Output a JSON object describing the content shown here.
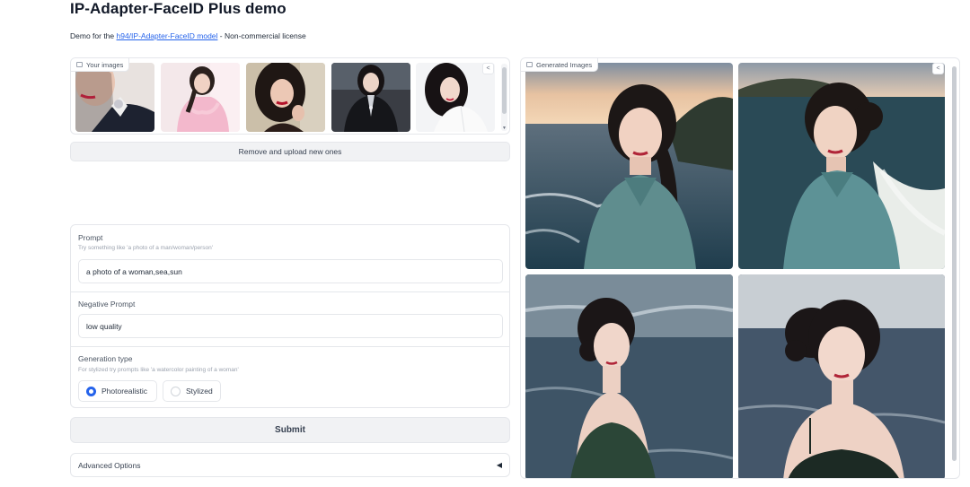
{
  "header": {
    "title": "IP-Adapter-FaceID Plus demo",
    "desc_prefix": "Demo for the ",
    "desc_link": "h94/IP-Adapter-FaceID model",
    "desc_suffix": " - Non-commercial license"
  },
  "input_gallery": {
    "label": "Your images",
    "thumbnail_count": 5
  },
  "remove_button": "Remove and upload new ones",
  "prompt": {
    "label": "Prompt",
    "info": "Try something like 'a photo of a man/woman/person'",
    "value": "a photo of a woman,sea,sun"
  },
  "negative_prompt": {
    "label": "Negative Prompt",
    "value": "low quality"
  },
  "generation_type": {
    "label": "Generation type",
    "info": "For stylized try prompts like 'a watercolor painting of a woman'",
    "options": [
      "Photorealistic",
      "Stylized"
    ],
    "selected": "Photorealistic"
  },
  "submit_button": "Submit",
  "advanced": {
    "label": "Advanced Options"
  },
  "output_gallery": {
    "label": "Generated Images",
    "image_count": 4
  },
  "colors": {
    "accent": "#2563eb",
    "border": "#e5e7eb",
    "button_bg": "#f1f2f4"
  }
}
